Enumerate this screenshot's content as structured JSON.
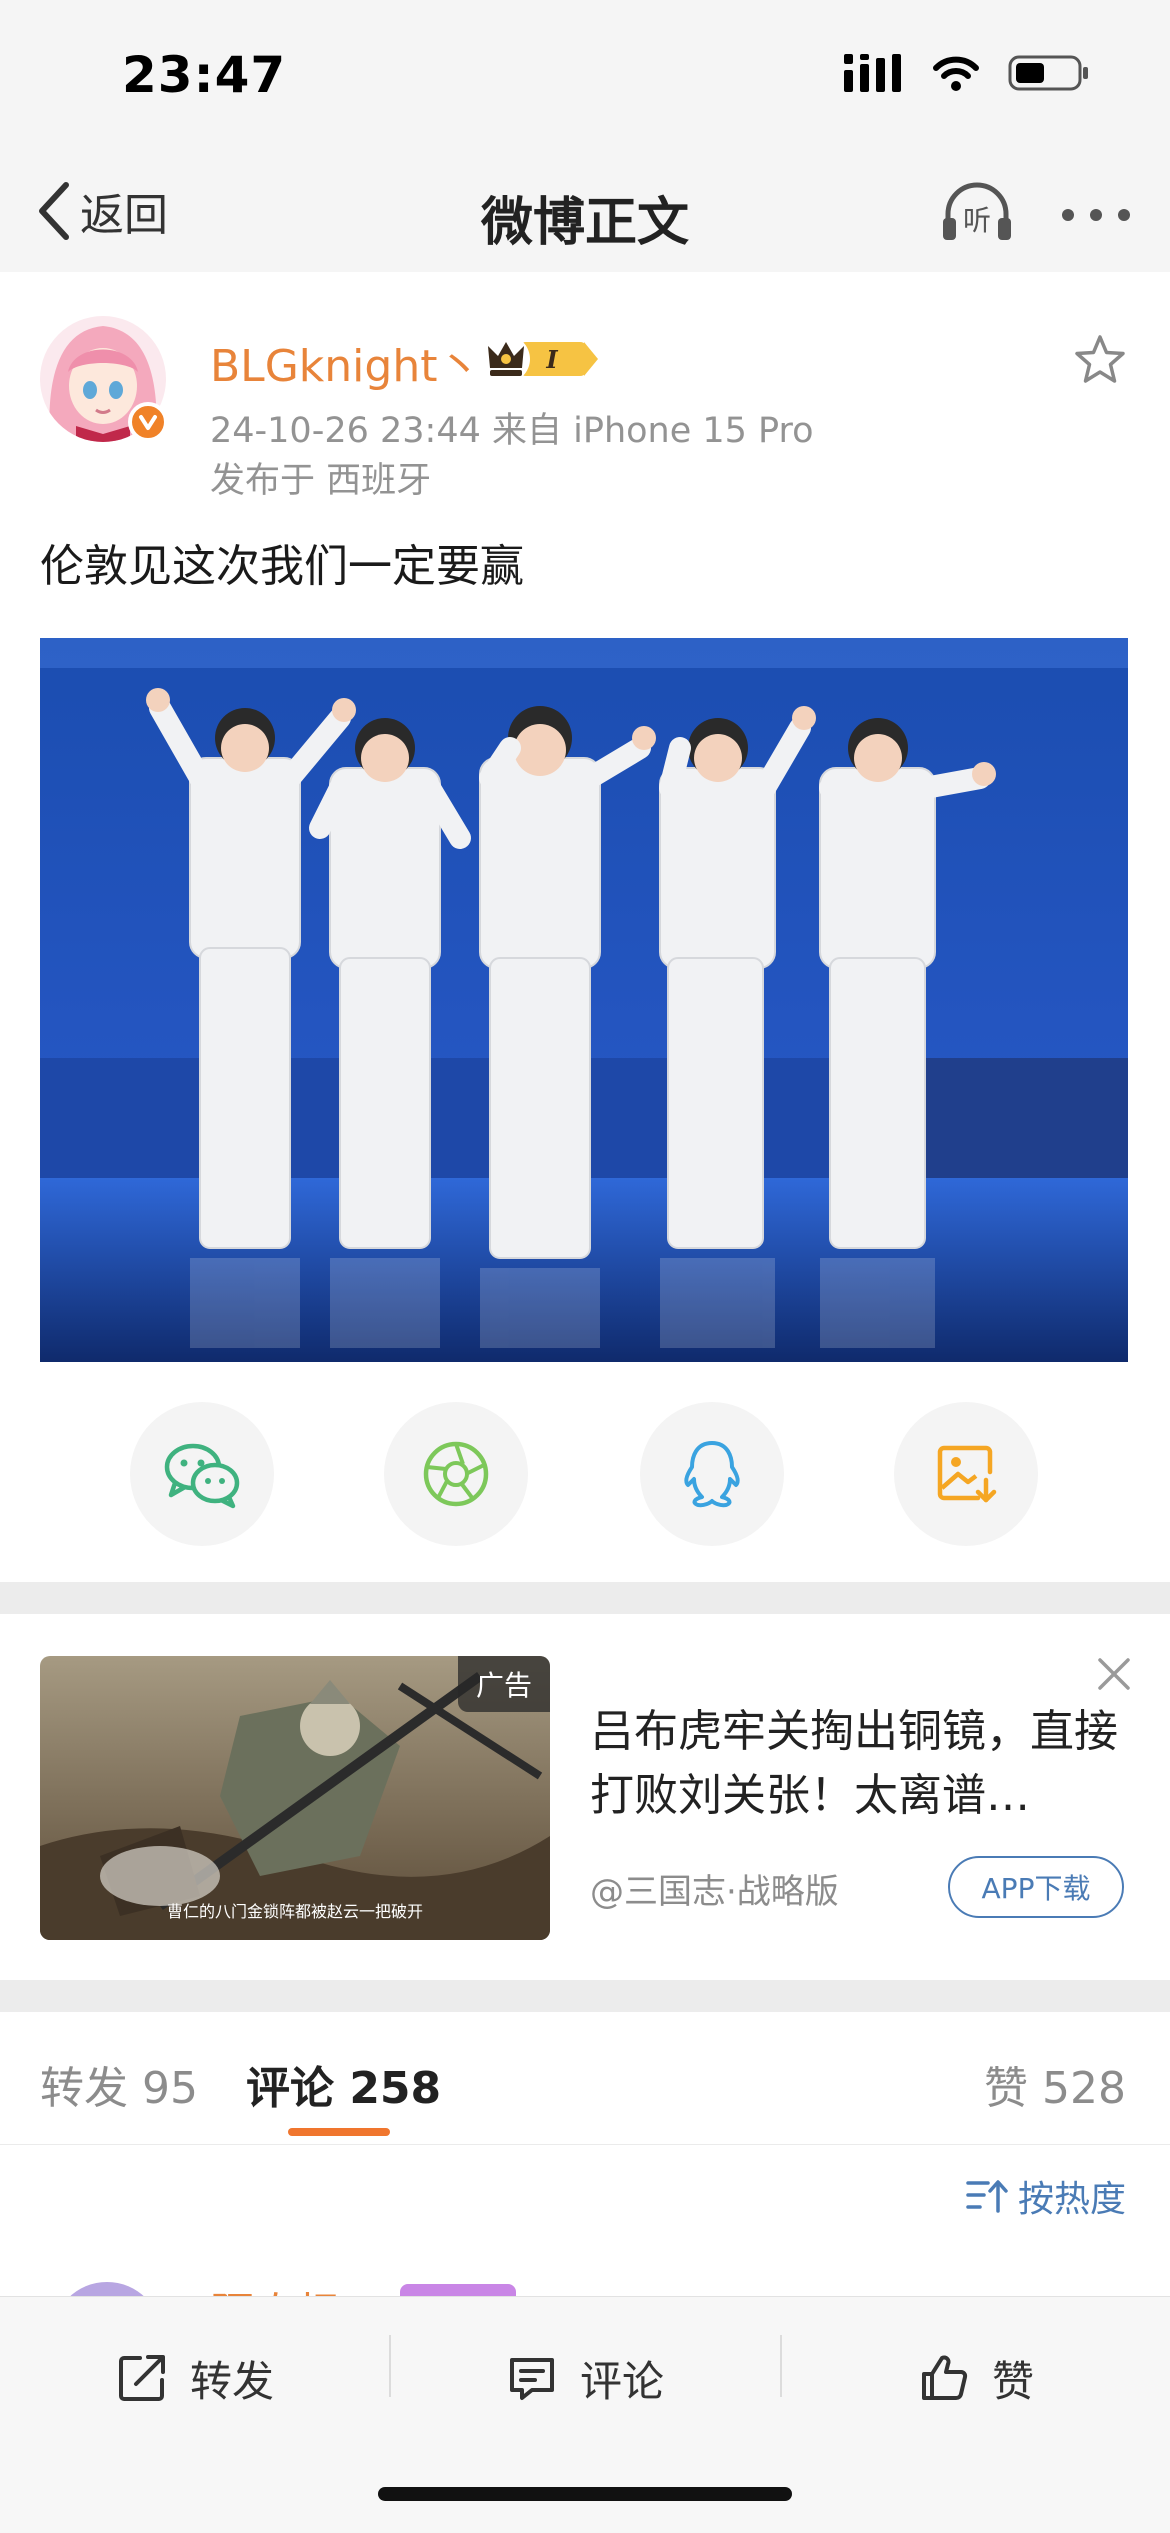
{
  "status_bar": {
    "time": "23:47"
  },
  "nav": {
    "back_label": "返回",
    "title": "微博正文",
    "listen_label": "听"
  },
  "post": {
    "username": "BLGknight丶",
    "badge_text": "I",
    "meta": "24-10-26 23:44  来自 iPhone 15 Pro",
    "location": "发布于 西班牙",
    "text": "伦敦见这次我们一定要赢"
  },
  "share": {
    "items": [
      {
        "icon": "wechat-icon",
        "color": "#3fb27f"
      },
      {
        "icon": "moments-icon",
        "color": "#7dc85a"
      },
      {
        "icon": "qq-icon",
        "color": "#3aa3e0"
      },
      {
        "icon": "save-image-icon",
        "color": "#f5a623"
      }
    ]
  },
  "ad": {
    "tag": "广告",
    "caption": "曹仁的八门金锁阵都被赵云一把破开",
    "title": "吕布虎牢关掏出铜镜，直接打败刘关张！太离谱…",
    "source": "@三国志·战略版",
    "download_label": "APP下载"
  },
  "tabs": {
    "repost": "转发 95",
    "comment": "评论 258",
    "like": "赞 528"
  },
  "sort": {
    "label": "按热度"
  },
  "comment_preview": {
    "name": "陌泰枫"
  },
  "bottom_bar": {
    "repost_label": "转发",
    "comment_label": "评论",
    "like_label": "赞"
  },
  "colors": {
    "accent": "#f0762e",
    "username": "#e8843a",
    "link": "#4a7bb5"
  }
}
